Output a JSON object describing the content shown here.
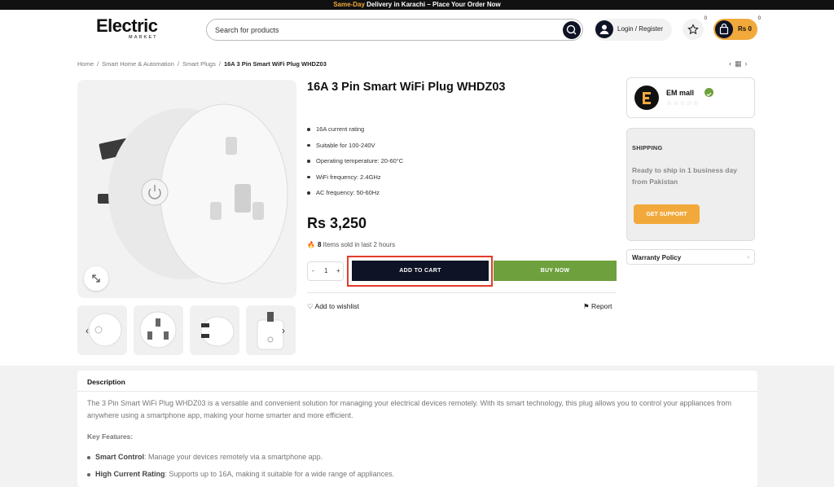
{
  "topbar": {
    "highlight": "Same-Day",
    "text": " Delivery in Karachi – Place Your Order Now"
  },
  "logo": {
    "main": "Electric",
    "sub": "MARKET"
  },
  "search": {
    "placeholder": "Search for products"
  },
  "account": {
    "label": "Login / Register"
  },
  "wishlist": {
    "count": "0"
  },
  "cart": {
    "amount": "Rs 0",
    "count": "0"
  },
  "breadcrumb": [
    "Home",
    "Smart Home & Automation",
    "Smart Plugs",
    "16A 3 Pin Smart WiFi Plug WHDZ03"
  ],
  "product": {
    "title": "16A 3 Pin Smart WiFi Plug WHDZ03",
    "features": [
      "16A current rating",
      "Suitable for 100-240V",
      "Operating temperature: 20-60°C",
      "WiFi frequency: 2.4GHz",
      "AC frequency: 50-60Hz"
    ],
    "price": "Rs 3,250",
    "sold_count": "8",
    "sold_text": "Items sold in last 2 hours",
    "qty": {
      "minus": "-",
      "value": "1",
      "plus": "+"
    },
    "add_to_cart": "ADD TO CART",
    "buy_now": "BUY NOW",
    "add_wishlist": "Add to wishlist",
    "report": "Report"
  },
  "seller": {
    "name": "EM mall",
    "stars": "☆☆☆☆☆"
  },
  "shipping": {
    "heading": "SHIPPING",
    "text": "Ready to ship in 1 business day from Pakistan",
    "button": "GET SUPPORT"
  },
  "warranty": {
    "label": "Warranty Policy"
  },
  "description": {
    "tab": "Description",
    "paragraph": "The 3 Pin Smart WiFi Plug WHDZ03 is a versatile and convenient solution for managing your electrical devices remotely. With its smart technology, this plug allows you to control your appliances from anywhere using a smartphone app, making your home smarter and more efficient.",
    "key_features_heading": "Key Features:",
    "items": [
      {
        "title": "Smart Control",
        "text": ": Manage your devices remotely via a smartphone app."
      },
      {
        "title": "High Current Rating",
        "text": ": Supports up to 16A, making it suitable for a wide range of appliances."
      }
    ]
  },
  "colors": {
    "navy": "#0e1325",
    "orange": "#f2a93b",
    "green": "#6ea03d",
    "highlight": "#e53b2b"
  }
}
